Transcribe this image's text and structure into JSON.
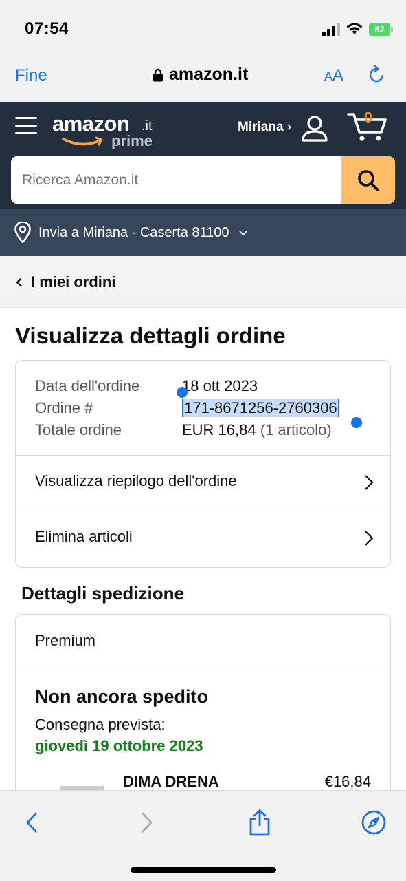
{
  "status_bar": {
    "time": "07:54",
    "battery": "82"
  },
  "safari": {
    "done_label": "Fine",
    "url": "amazon.it",
    "text_size_small": "A",
    "text_size_big": "A"
  },
  "header": {
    "logo_word": "amazon",
    "logo_tld": ".it",
    "logo_prime": "prime",
    "account_label": "Miriana ›",
    "cart_count": "0"
  },
  "search": {
    "placeholder": "Ricerca Amazon.it"
  },
  "deliver_to": "Invia a Miriana - Caserta 81100",
  "breadcrumb": "I miei ordini",
  "page_title": "Visualizza dettagli ordine",
  "order_info": {
    "date_label": "Data dell'ordine",
    "date_value": "18 ott 2023",
    "number_label": "Ordine #",
    "number_value": "171-8671256-2760306",
    "total_label": "Totale ordine",
    "total_value": "EUR 16,84",
    "total_items": "(1 articolo)"
  },
  "order_links": {
    "summary": "Visualizza riepilogo dell'ordine",
    "remove_items": "Elimina articoli"
  },
  "shipping": {
    "section_title": "Dettagli spedizione",
    "method": "Premium",
    "status": "Non ancora spedito",
    "delivery_label": "Consegna prevista:",
    "delivery_date": "giovedì 19 ottobre 2023",
    "product_name": "DIMA DRENA",
    "product_price": "€16,84"
  },
  "colors": {
    "header_bg": "#232f3e",
    "deliver_bg": "#37475a",
    "search_button": "#febd69",
    "safari_blue": "#1a73e8",
    "delivery_green": "#118014",
    "cart_orange": "#f08804"
  }
}
